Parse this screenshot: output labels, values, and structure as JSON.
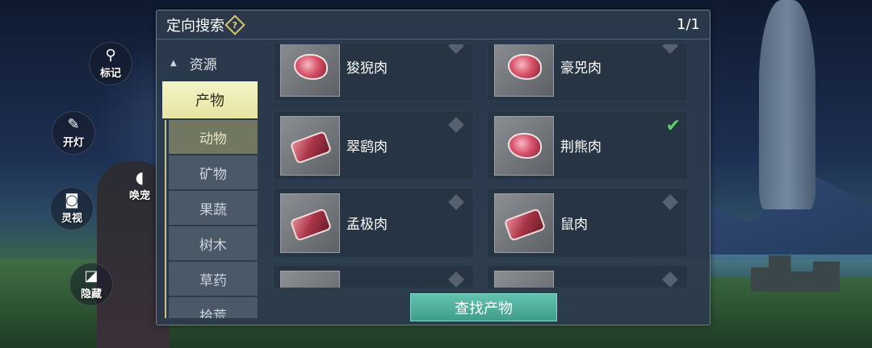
{
  "hud": {
    "mark_label": "标记",
    "light_label": "开灯",
    "camera_label": "灵视",
    "whistle_label": "唤宠",
    "hide_label": "隐藏"
  },
  "panel": {
    "title": "定向搜索",
    "help_symbol": "?",
    "page_indicator": "1/1"
  },
  "sidebar": {
    "parent": "资源",
    "selected": "产物",
    "sub_items": [
      "动物",
      "矿物",
      "果蔬",
      "树木",
      "草药",
      "拾荒"
    ]
  },
  "items": [
    {
      "name": "狻猊肉",
      "icon": "meat-round-icon",
      "checked": false
    },
    {
      "name": "豪兕肉",
      "icon": "meat-round-icon",
      "checked": false
    },
    {
      "name": "翠鹞肉",
      "icon": "meat-steak-icon",
      "checked": false
    },
    {
      "name": "荆熊肉",
      "icon": "meat-round-icon",
      "checked": true
    },
    {
      "name": "孟极肉",
      "icon": "meat-steak-icon",
      "checked": false
    },
    {
      "name": "鼠肉",
      "icon": "meat-steak-icon",
      "checked": false
    },
    {
      "name": "",
      "icon": "item-icon",
      "checked": false
    },
    {
      "name": "",
      "icon": "item-icon",
      "checked": false
    }
  ],
  "find_button": "查找产物",
  "colors": {
    "accent_selected": "#e7e5a3",
    "button": "#4fae9b",
    "check": "#5ed36a"
  }
}
